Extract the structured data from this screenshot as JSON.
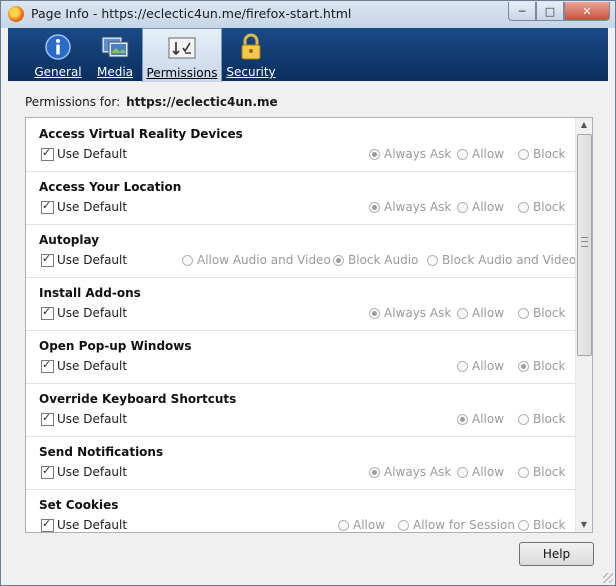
{
  "window": {
    "title": "Page Info - https://eclectic4un.me/firefox-start.html",
    "app_icon": "firefox-icon"
  },
  "tabs": [
    {
      "label": "General",
      "icon": "info-icon",
      "selected": false
    },
    {
      "label": "Media",
      "icon": "media-icon",
      "selected": false
    },
    {
      "label": "Permissions",
      "icon": "permissions-icon",
      "selected": true
    },
    {
      "label": "Security",
      "icon": "lock-icon",
      "selected": false
    }
  ],
  "permissions_for": {
    "label": "Permissions for:",
    "host": "https://eclectic4un.me"
  },
  "permissions": [
    {
      "name": "Access Virtual Reality Devices",
      "use_default": "Use Default",
      "options": [
        "Always Ask",
        "Allow",
        "Block"
      ],
      "selected": "Always Ask"
    },
    {
      "name": "Access Your Location",
      "use_default": "Use Default",
      "options": [
        "Always Ask",
        "Allow",
        "Block"
      ],
      "selected": "Always Ask"
    },
    {
      "name": "Autoplay",
      "use_default": "Use Default",
      "options": [
        "Allow Audio and Video",
        "Block Audio",
        "Block Audio and Video"
      ],
      "selected": "Block Audio"
    },
    {
      "name": "Install Add-ons",
      "use_default": "Use Default",
      "options": [
        "Always Ask",
        "Allow",
        "Block"
      ],
      "selected": "Always Ask"
    },
    {
      "name": "Open Pop-up Windows",
      "use_default": "Use Default",
      "options": [
        "Allow",
        "Block"
      ],
      "selected": "Block"
    },
    {
      "name": "Override Keyboard Shortcuts",
      "use_default": "Use Default",
      "options": [
        "Allow",
        "Block"
      ],
      "selected": "Allow"
    },
    {
      "name": "Send Notifications",
      "use_default": "Use Default",
      "options": [
        "Always Ask",
        "Allow",
        "Block"
      ],
      "selected": "Always Ask"
    },
    {
      "name": "Set Cookies",
      "use_default": "Use Default",
      "options": [
        "Allow",
        "Allow for Session",
        "Block"
      ],
      "selected": ""
    }
  ],
  "help_button": "Help",
  "colors": {
    "toolbar": "#0b3568",
    "selected_tab": "#dbe5f1"
  }
}
